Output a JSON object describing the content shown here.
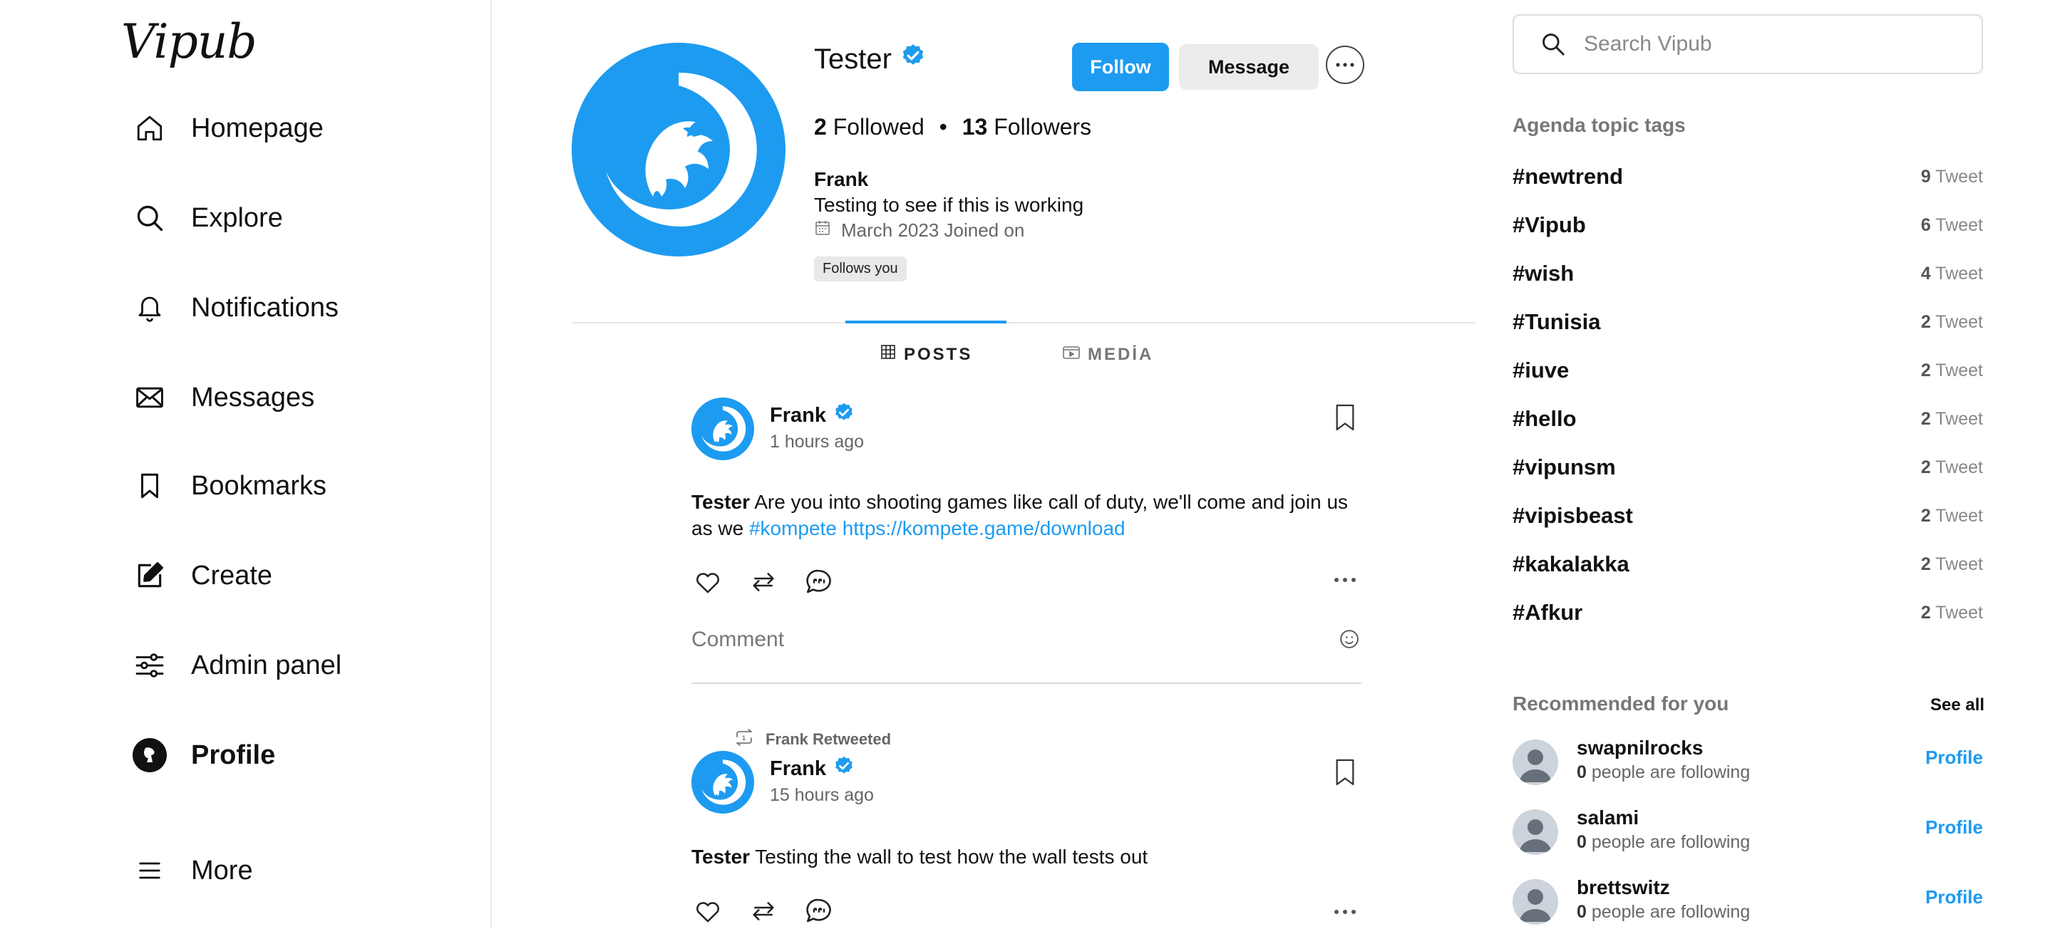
{
  "app": {
    "logo_text": "Vipub"
  },
  "sidebar": {
    "items": [
      {
        "label": "Homepage",
        "icon": "home-icon"
      },
      {
        "label": "Explore",
        "icon": "search-icon"
      },
      {
        "label": "Notifications",
        "icon": "bell-icon"
      },
      {
        "label": "Messages",
        "icon": "envelope-icon"
      },
      {
        "label": "Bookmarks",
        "icon": "bookmark-icon"
      },
      {
        "label": "Create",
        "icon": "edit-icon"
      },
      {
        "label": "Admin panel",
        "icon": "sliders-icon"
      },
      {
        "label": "Profile",
        "icon": "profile-avatar-icon",
        "active": true
      },
      {
        "label": "More",
        "icon": "menu-icon"
      }
    ]
  },
  "profile": {
    "name": "Tester",
    "verified": true,
    "follow_label": "Follow",
    "message_label": "Message",
    "followed_count": "2",
    "followed_label": "Followed",
    "separator": "•",
    "followers_count": "13",
    "followers_label": "Followers",
    "display_name": "Frank",
    "bio": "Testing to see if this is working",
    "joined": "March 2023 Joined on",
    "follows_you": "Follows you",
    "brand_color": "#1d9bf0"
  },
  "tabs": [
    {
      "label": "POSTS",
      "icon": "grid-icon",
      "active": true
    },
    {
      "label": "MEDİA",
      "icon": "video-icon",
      "active": false
    }
  ],
  "posts": [
    {
      "author": "Frank",
      "time": "1 hours ago",
      "text_author": "Tester",
      "text_before": " Are you into shooting games like call of duty, we'll come and join us as we ",
      "hashtag": "#kompete",
      "link": "https://kompete.game/download",
      "comment_placeholder": "Comment"
    },
    {
      "retweeted_by": "Frank Retweeted",
      "author": "Frank",
      "time": "15 hours ago",
      "text_author": "Tester",
      "text_body": " Testing the wall to test how the wall tests out"
    }
  ],
  "right": {
    "search_placeholder": "Search Vipub",
    "tags_title": "Agenda topic tags",
    "tweet_word": "Tweet",
    "tags": [
      {
        "tag": "#newtrend",
        "count": "9"
      },
      {
        "tag": "#Vipub",
        "count": "6"
      },
      {
        "tag": "#wish",
        "count": "4"
      },
      {
        "tag": "#Tunisia",
        "count": "2"
      },
      {
        "tag": "#iuve",
        "count": "2"
      },
      {
        "tag": "#hello",
        "count": "2"
      },
      {
        "tag": "#vipunsm",
        "count": "2"
      },
      {
        "tag": "#vipisbeast",
        "count": "2"
      },
      {
        "tag": "#kakalakka",
        "count": "2"
      },
      {
        "tag": "#Afkur",
        "count": "2"
      }
    ],
    "recommended_title": "Recommended for you",
    "see_all": "See all",
    "recommended": [
      {
        "name": "swapnilrocks",
        "count": "0",
        "suffix": "people are following",
        "action": "Profile"
      },
      {
        "name": "salami",
        "count": "0",
        "suffix": "people are following",
        "action": "Profile"
      },
      {
        "name": "brettswitz",
        "count": "0",
        "suffix": "people are following",
        "action": "Profile"
      }
    ]
  }
}
